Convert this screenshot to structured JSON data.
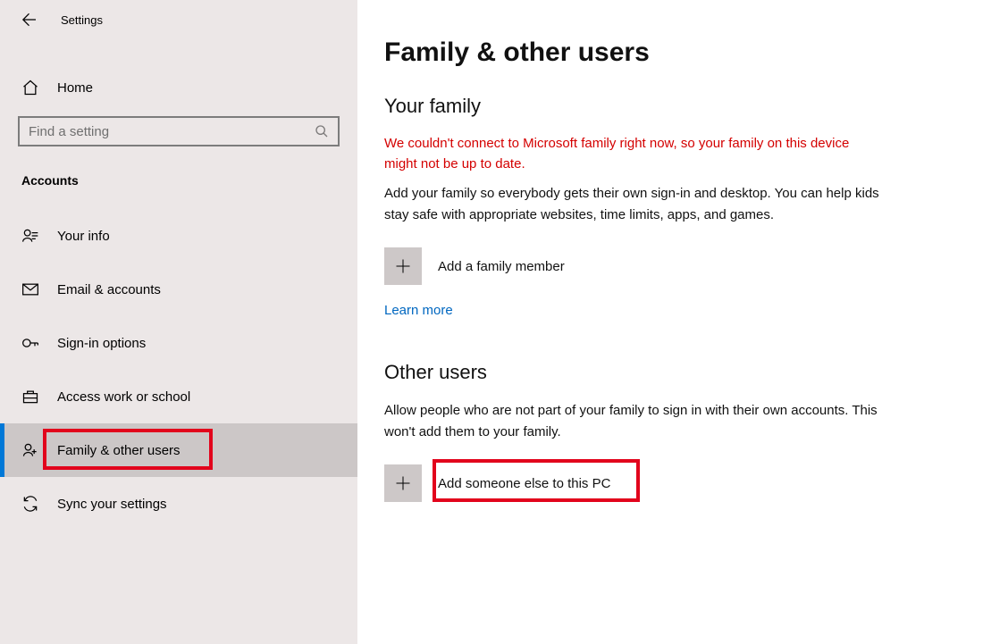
{
  "header": {
    "settings_label": "Settings",
    "home_label": "Home",
    "search_placeholder": "Find a setting"
  },
  "sidebar": {
    "section": "Accounts",
    "items": [
      {
        "label": "Your info"
      },
      {
        "label": "Email & accounts"
      },
      {
        "label": "Sign-in options"
      },
      {
        "label": "Access work or school"
      },
      {
        "label": "Family & other users"
      },
      {
        "label": "Sync your settings"
      }
    ]
  },
  "main": {
    "title": "Family & other users",
    "family": {
      "heading": "Your family",
      "error": "We couldn't connect to Microsoft family right now, so your family on this device might not be up to date.",
      "description": "Add your family so everybody gets their own sign-in and desktop. You can help kids stay safe with appropriate websites, time limits, apps, and games.",
      "add_label": "Add a family member",
      "learn_more": "Learn more"
    },
    "other": {
      "heading": "Other users",
      "description": "Allow people who are not part of your family to sign in with their own accounts. This won't add them to your family.",
      "add_label": "Add someone else to this PC"
    }
  }
}
